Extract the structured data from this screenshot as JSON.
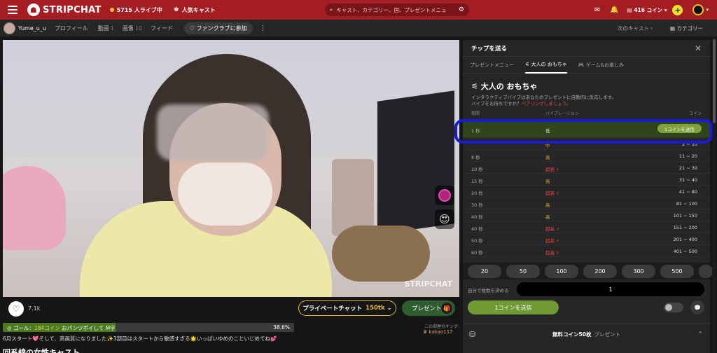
{
  "header": {
    "brand": "STRIPCHAT",
    "live": "5715 人ライブ中",
    "popular": "人気キャスト",
    "search_placeholder": "キャスト、カテゴリー、国、プレゼントメニュ",
    "coins": "416 コイン"
  },
  "subbar": {
    "username": "Yume_u_u",
    "tabs": [
      {
        "label": "プロフィール",
        "count": ""
      },
      {
        "label": "動画",
        "count": "1"
      },
      {
        "label": "画像",
        "count": "10"
      },
      {
        "label": "フィード",
        "count": ""
      }
    ],
    "fanclub": "ファンクラブに参加",
    "next": "次のキャスト",
    "category": "カテゴリー"
  },
  "video": {
    "watermark": "STRIPCHAT"
  },
  "controls": {
    "likes": "7.1k",
    "private_label": "プライベートチャット",
    "private_price": "150tk",
    "gift_label": "プレゼント"
  },
  "goal": {
    "label": "ゴール：",
    "coins": "184コイン",
    "text": "おパンツポイして M字",
    "percent": "38.6%",
    "progress": 0.386
  },
  "king": {
    "label": "この部屋のキング:",
    "name": "kakao117"
  },
  "description": "6月スタート💖そして、高画質になりました✨3部目はスタートから敏感すぎる🌟いっぱいゆめのこといじめてね💕",
  "description2": "回系線の女性キャスト",
  "tip_panel": {
    "title": "チップを送る",
    "tabs": [
      "プレゼントメニュー",
      "大人の おもちゃ",
      "ゲーム&お楽しみ"
    ],
    "active_tab": 1,
    "heading": "大人の おもちゃ",
    "desc_line1": "インタラクティブバイブはあなたのプレゼントに自動的に反応します。",
    "desc_line2": "バイブをお持ちですか？",
    "desc_link": "ペアリングしましょう。",
    "col_duration": "期間",
    "col_vibration": "バイブレーション",
    "col_coins": "コイン",
    "send_one": "1コインを送信",
    "rows": [
      {
        "duration": "1 秒",
        "level": "低",
        "coins": "",
        "selected": true
      },
      {
        "duration": "",
        "level": "中",
        "coins": "2 ~ 10",
        "selected": false
      },
      {
        "duration": "8 秒",
        "level": "高",
        "coins": "11 ~ 20",
        "selected": false
      },
      {
        "duration": "10 秒",
        "level": "超高 ⚡",
        "coins": "21 ~ 30",
        "red": true
      },
      {
        "duration": "15 秒",
        "level": "高",
        "coins": "31 ~ 40",
        "selected": false
      },
      {
        "duration": "20 秒",
        "level": "超高 ⚡",
        "coins": "41 ~ 80",
        "red": true
      },
      {
        "duration": "30 秒",
        "level": "高",
        "coins": "81 ~ 100",
        "selected": false
      },
      {
        "duration": "40 秒",
        "level": "高",
        "coins": "101 ~ 150",
        "selected": false
      },
      {
        "duration": "40 秒",
        "level": "超高 ⚡",
        "coins": "151 ~ 200",
        "red": true
      },
      {
        "duration": "50 秒",
        "level": "超高 ⚡",
        "coins": "201 ~ 400",
        "red": true
      },
      {
        "duration": "60 秒",
        "level": "超高 ⚡",
        "coins": "401 ~ 500",
        "red": true
      }
    ],
    "amounts": [
      "20",
      "50",
      "100",
      "200",
      "300",
      "500",
      ""
    ],
    "custom_label": "自分で枚数を決める",
    "custom_value": "1",
    "send_label": "1コインを送信",
    "free_bold": "無料コイン50枚",
    "free_rest": "プレゼント"
  }
}
